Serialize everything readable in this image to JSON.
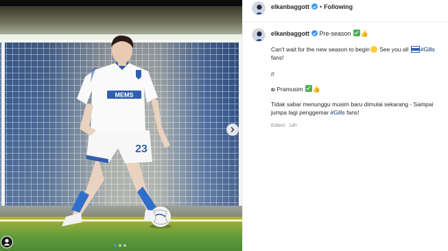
{
  "post": {
    "username": "elkanbaggott",
    "follow_label": "Following",
    "separator": "•",
    "caption_title": "Pre-season",
    "caption_en_part1": "Can't wait for the new season to begin",
    "caption_en_part2": " See you all ",
    "caption_en_hashtag": "#Gills",
    "caption_en_part3": " fans!",
    "divider": "//",
    "caption_id_flag": "ID",
    "caption_id_title": "Pramusim",
    "caption_id_part1": "Tidak sabar menunggu musim baru dimulai sekarang - Sampai jumpa lagi penggemar ",
    "caption_id_hashtag": "#Gills",
    "caption_id_part2": " fans!",
    "edited": "Edited · 14h"
  },
  "photo": {
    "jersey_sponsor": "MEMS",
    "shirt_number": "23",
    "carousel_total": 3,
    "carousel_active": 1
  },
  "icons": {
    "verified": "verified-badge-icon",
    "next": "chevron-right-icon",
    "user": "user-tag-icon"
  },
  "colors": {
    "link": "#00376b",
    "verified": "#3897f0",
    "meta": "#8e8e8e"
  }
}
